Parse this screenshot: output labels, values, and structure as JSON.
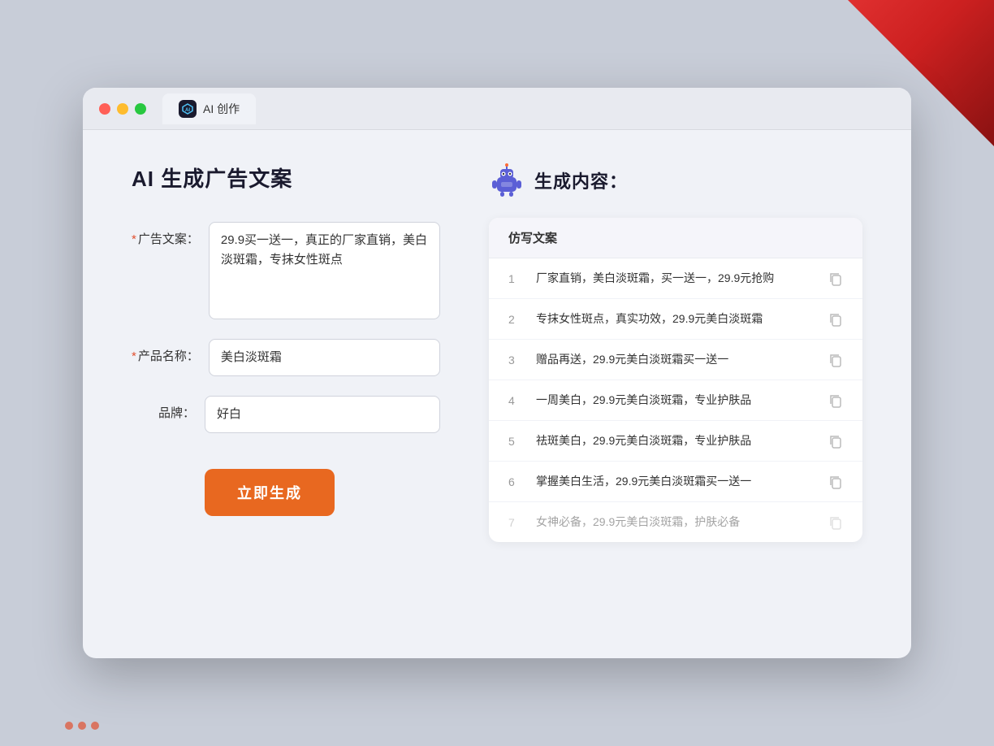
{
  "background": {
    "color": "#c8cdd8"
  },
  "browser": {
    "tab_icon_text": "AI",
    "tab_label": "AI 创作"
  },
  "left_panel": {
    "page_title": "AI 生成广告文案",
    "form": {
      "ad_copy_label": "广告文案：",
      "ad_copy_required": true,
      "ad_copy_value": "29.9买一送一，真正的厂家直销，美白淡斑霜，专抹女性斑点",
      "product_name_label": "产品名称：",
      "product_name_required": true,
      "product_name_value": "美白淡斑霜",
      "brand_label": "品牌：",
      "brand_required": false,
      "brand_value": "好白"
    },
    "generate_button": "立即生成"
  },
  "right_panel": {
    "title": "生成内容：",
    "table_header": "仿写文案",
    "results": [
      {
        "num": "1",
        "text": "厂家直销，美白淡斑霜，买一送一，29.9元抢购",
        "faded": false
      },
      {
        "num": "2",
        "text": "专抹女性斑点，真实功效，29.9元美白淡斑霜",
        "faded": false
      },
      {
        "num": "3",
        "text": "赠品再送，29.9元美白淡斑霜买一送一",
        "faded": false
      },
      {
        "num": "4",
        "text": "一周美白，29.9元美白淡斑霜，专业护肤品",
        "faded": false
      },
      {
        "num": "5",
        "text": "祛斑美白，29.9元美白淡斑霜，专业护肤品",
        "faded": false
      },
      {
        "num": "6",
        "text": "掌握美白生活，29.9元美白淡斑霜买一送一",
        "faded": false
      },
      {
        "num": "7",
        "text": "女神必备，29.9元美白淡斑霜，护肤必备",
        "faded": true
      }
    ]
  }
}
